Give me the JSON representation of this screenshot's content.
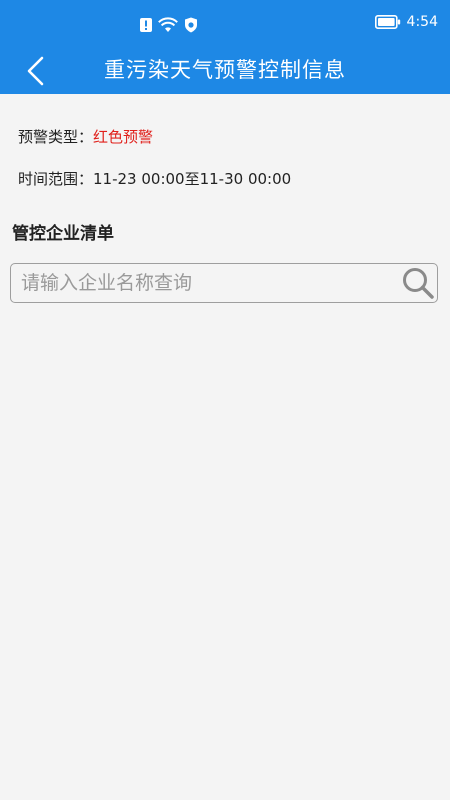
{
  "status_bar": {
    "time": "4:54",
    "icons": [
      "alert-icon",
      "wifi-icon",
      "vpn-shield-icon",
      "battery-icon"
    ],
    "color": "#1e88e5"
  },
  "app_bar": {
    "back_icon": "chevron-left-icon",
    "title": "重污染天气预警控制信息"
  },
  "warning_info": {
    "type_label": "预警类型：",
    "type_value": "红色预警",
    "type_value_color": "#e0201b",
    "time_label": "时间范围：",
    "time_value": "11-23 00:00至11-30 00:00"
  },
  "enterprise_list": {
    "section_title": "管控企业清单",
    "search_placeholder": "请输入企业名称查询",
    "search_value": "",
    "search_icon": "search-icon"
  }
}
